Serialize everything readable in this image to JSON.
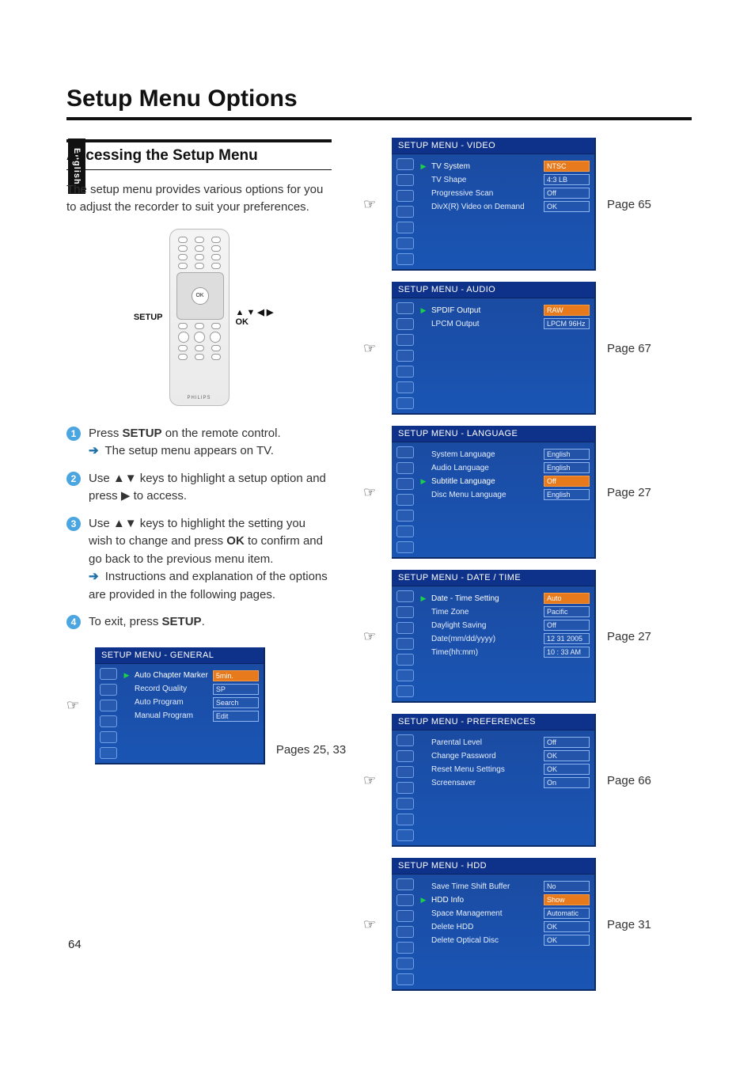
{
  "page_number": "64",
  "side_tab": "English",
  "title": "Setup Menu Options",
  "section_heading": "Accessing the Setup Menu",
  "intro_paragraph": "The setup menu provides various options for you to adjust the recorder to suit your preferences.",
  "remote": {
    "label_left": "SETUP",
    "label_right_arrows": "▲ ▼ ◀ ▶",
    "label_right_ok": "OK",
    "brand": "PHILIPS"
  },
  "steps": [
    {
      "n": "1",
      "lines": [
        "Press <b>SETUP</b> on the remote control.",
        "<span class='arrow-sub'>➔</span> The setup menu appears on TV."
      ]
    },
    {
      "n": "2",
      "lines": [
        "Use <span class='glyph'>▲▼</span> keys to highlight a setup option and press <span class='glyph'>▶</span> to access."
      ]
    },
    {
      "n": "3",
      "lines": [
        "Use <span class='glyph'>▲▼</span> keys to highlight the setting you wish to change and press <b>OK</b> to confirm and go back to the previous menu item.",
        "<span class='arrow-sub'>➔</span> Instructions and explanation of the options are provided in the following pages."
      ]
    },
    {
      "n": "4",
      "lines": [
        "To exit, press <b>SETUP</b>."
      ]
    }
  ],
  "menus": {
    "general": {
      "title": "SETUP MENU - GENERAL",
      "page_ref": "Pages 25, 33",
      "selected": 0,
      "rows": [
        {
          "label": "Auto Chapter Marker",
          "value": "5min."
        },
        {
          "label": "Record Quality",
          "value": "SP"
        },
        {
          "label": "Auto Program",
          "value": "Search"
        },
        {
          "label": "Manual Program",
          "value": "Edit"
        }
      ]
    },
    "video": {
      "title": "SETUP MENU - VIDEO",
      "page_ref": "Page 65",
      "selected": 0,
      "rows": [
        {
          "label": "TV System",
          "value": "NTSC"
        },
        {
          "label": "TV Shape",
          "value": "4:3 LB"
        },
        {
          "label": "Progressive Scan",
          "value": "Off"
        },
        {
          "label": "DivX(R) Video on Demand",
          "value": "OK"
        }
      ]
    },
    "audio": {
      "title": "SETUP MENU - AUDIO",
      "page_ref": "Page 67",
      "selected": 0,
      "rows": [
        {
          "label": "SPDIF Output",
          "value": "RAW"
        },
        {
          "label": "LPCM Output",
          "value": "LPCM 96Hz"
        }
      ]
    },
    "language": {
      "title": "SETUP MENU - LANGUAGE",
      "page_ref": "Page 27",
      "selected": 2,
      "rows": [
        {
          "label": "System Language",
          "value": "English"
        },
        {
          "label": "Audio Language",
          "value": "English"
        },
        {
          "label": "Subtitle Language",
          "value": "Off"
        },
        {
          "label": "Disc Menu Language",
          "value": "English"
        }
      ]
    },
    "datetime": {
      "title": "SETUP MENU - DATE / TIME",
      "page_ref": "Page 27",
      "selected": 0,
      "rows": [
        {
          "label": "Date - Time Setting",
          "value": "Auto"
        },
        {
          "label": "Time Zone",
          "value": "Pacific"
        },
        {
          "label": "Daylight Saving",
          "value": "Off"
        },
        {
          "label": "Date(mm/dd/yyyy)",
          "value": "12  31  2005"
        },
        {
          "label": "Time(hh:mm)",
          "value": "10 : 33  AM"
        }
      ]
    },
    "preferences": {
      "title": "SETUP MENU - PREFERENCES",
      "page_ref": "Page 66",
      "selected": -1,
      "rows": [
        {
          "label": "Parental Level",
          "value": "Off"
        },
        {
          "label": "Change Password",
          "value": "OK"
        },
        {
          "label": "Reset Menu Settings",
          "value": "OK"
        },
        {
          "label": "Screensaver",
          "value": "On"
        }
      ]
    },
    "hdd": {
      "title": "SETUP MENU - HDD",
      "page_ref": "Page 31",
      "selected": 1,
      "rows": [
        {
          "label": "Save Time Shift Buffer",
          "value": "No"
        },
        {
          "label": "HDD Info",
          "value": "Show"
        },
        {
          "label": "Space Management",
          "value": "Automatic"
        },
        {
          "label": "Delete HDD",
          "value": "OK"
        },
        {
          "label": "Delete Optical Disc",
          "value": "OK"
        }
      ]
    }
  }
}
